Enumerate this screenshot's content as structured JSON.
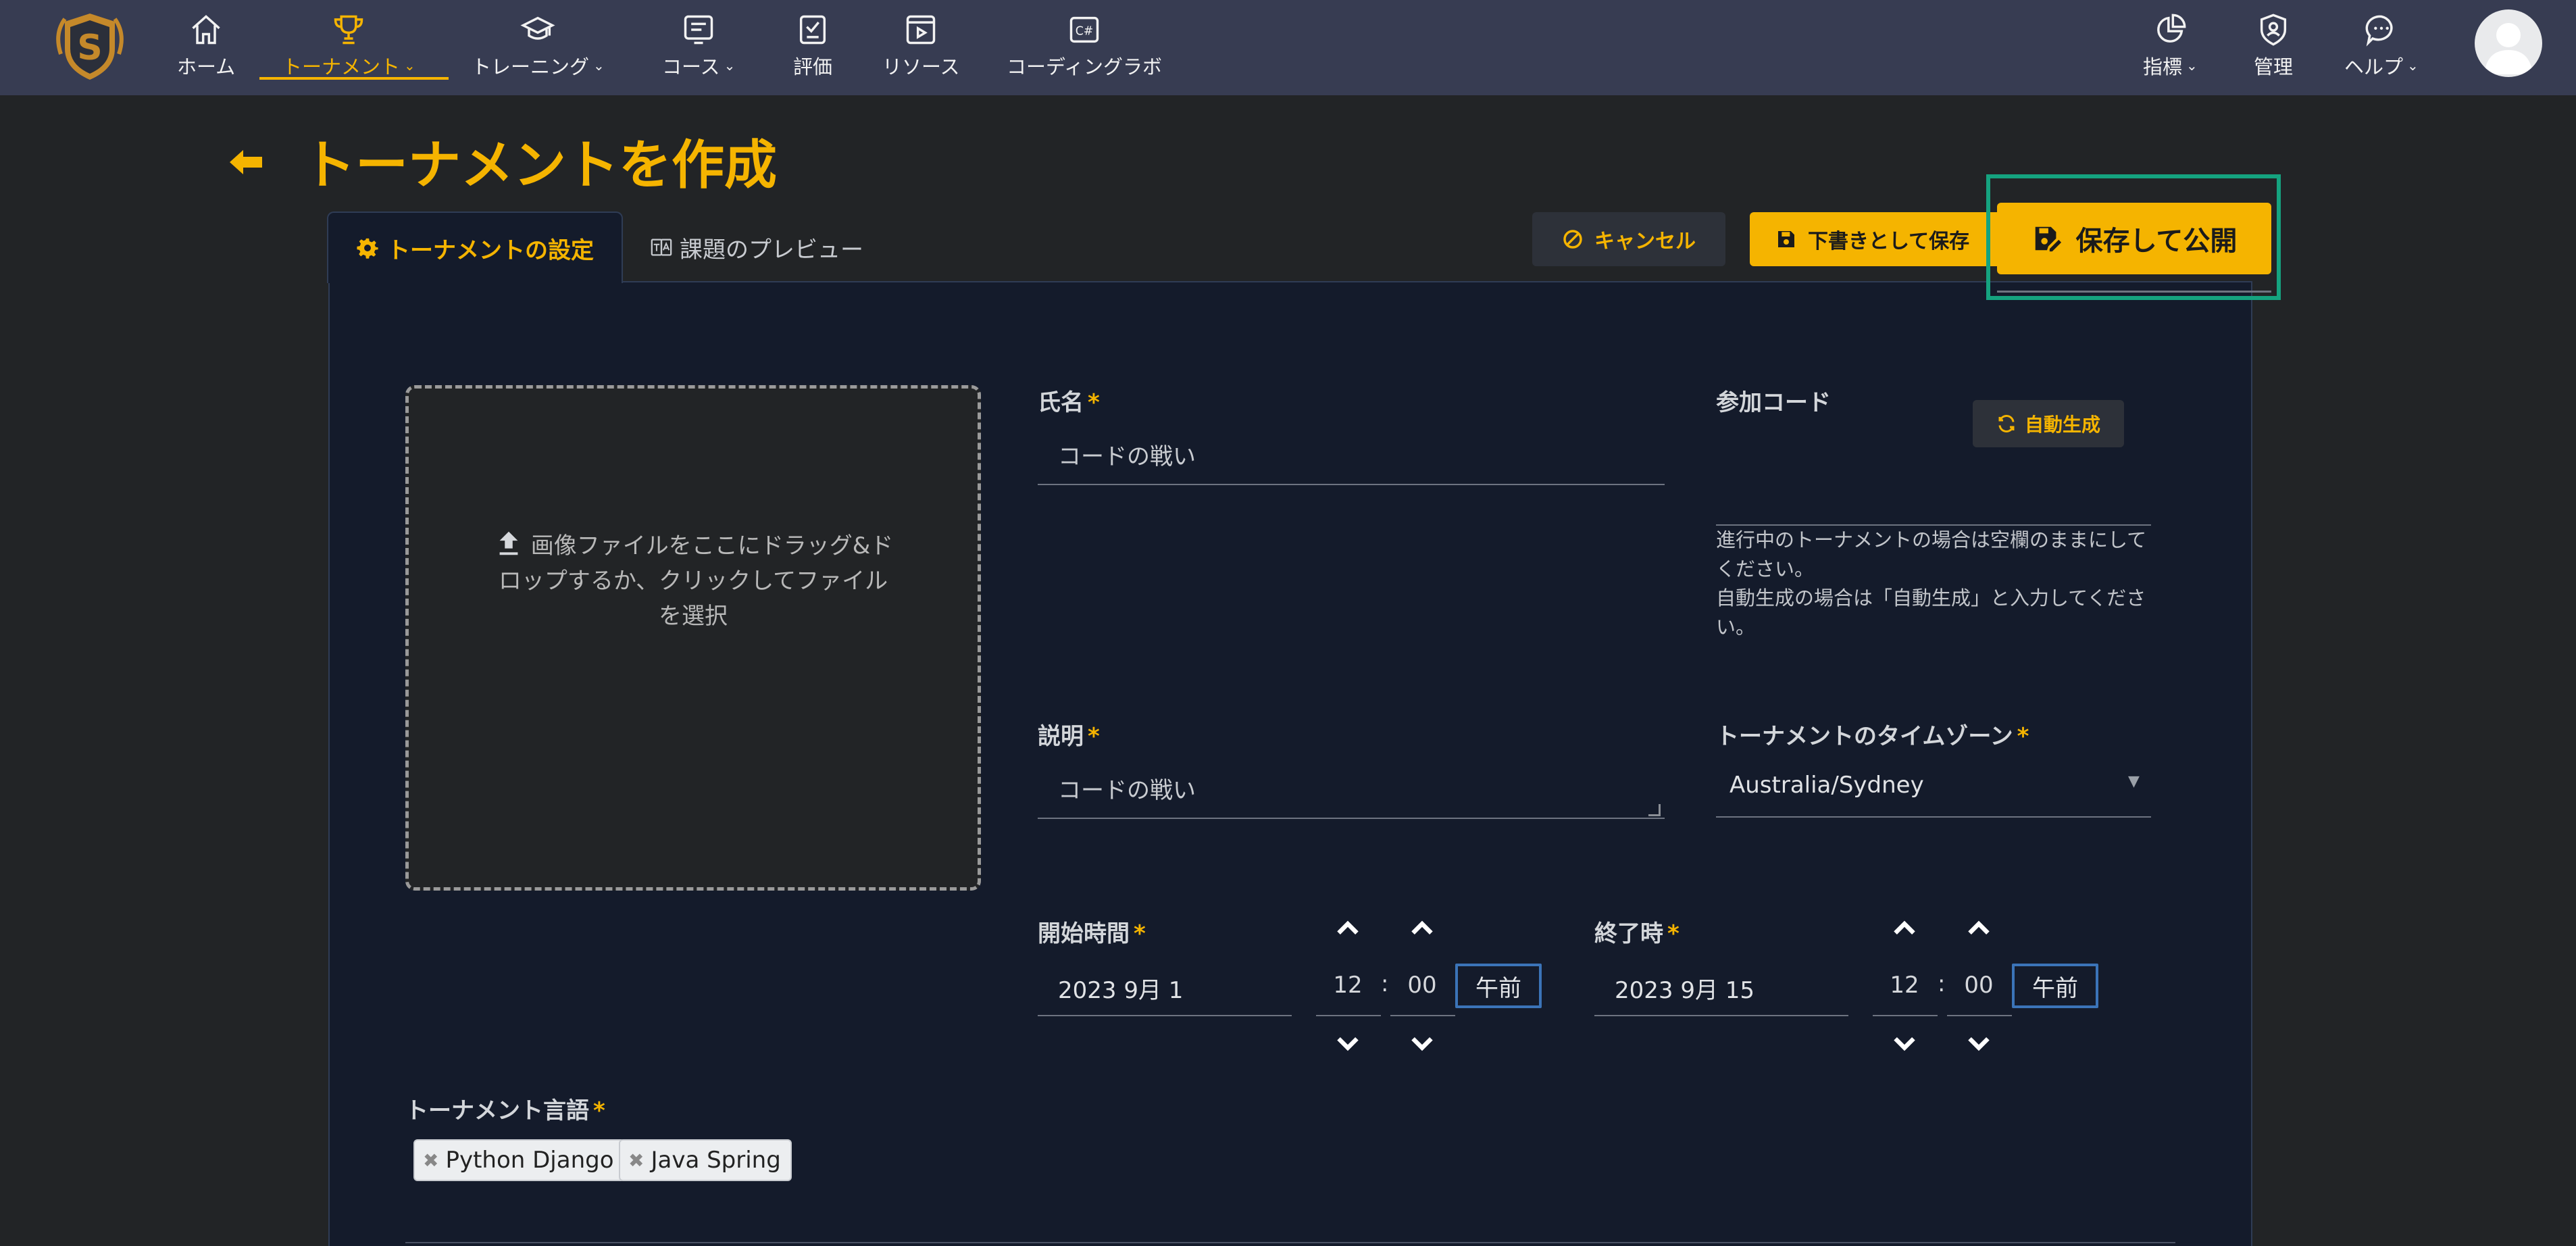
{
  "nav": {
    "items": [
      {
        "label": "ホーム",
        "icon": "home-icon"
      },
      {
        "label": "トーナメント",
        "icon": "trophy-icon",
        "dropdown": true,
        "active": true
      },
      {
        "label": "トレーニング",
        "icon": "graduation-cap-icon",
        "dropdown": true
      },
      {
        "label": "コース",
        "icon": "course-icon",
        "dropdown": true
      },
      {
        "label": "評価",
        "icon": "assessment-icon"
      },
      {
        "label": "リソース",
        "icon": "video-resource-icon"
      },
      {
        "label": "コーディングラボ",
        "icon": "code-lab-icon"
      }
    ],
    "right_items": [
      {
        "label": "指標",
        "icon": "pie-chart-icon",
        "dropdown": true
      },
      {
        "label": "管理",
        "icon": "admin-icon"
      },
      {
        "label": "ヘルプ",
        "icon": "chat-help-icon",
        "dropdown": true
      }
    ],
    "chevron": "⌄"
  },
  "page": {
    "title": "トーナメントを作成"
  },
  "tabs": {
    "settings": "トーナメントの設定",
    "preview": "課題のプレビュー"
  },
  "actions": {
    "cancel": "キャンセル",
    "save_draft": "下書きとして保存",
    "save_publish": "保存して公開"
  },
  "dropzone": {
    "text": "画像ファイルをここにドラッグ&ドロップするか、クリックしてファイルを選択"
  },
  "form": {
    "name_label": "氏名",
    "name_value": "コードの戦い",
    "join_code_label": "参加コード",
    "auto_generate": "自動生成",
    "join_code_hint_1": "進行中のトーナメントの場合は空欄のままにしてください。",
    "join_code_hint_2": "自動生成の場合は「自動生成」と入力してください。",
    "description_label": "説明",
    "description_value": "コードの戦い",
    "timezone_label": "トーナメントのタイムゾーン",
    "timezone_value": "Australia/Sydney",
    "start_label": "開始時間",
    "start_date": "2023 9月 1",
    "start_hour": "12",
    "start_minute": "00",
    "start_ampm": "午前",
    "end_label": "終了時",
    "end_date": "2023 9月 15",
    "end_hour": "12",
    "end_minute": "00",
    "end_ampm": "午前",
    "language_label": "トーナメント言語",
    "languages": [
      "Python Django",
      "Java Spring"
    ],
    "required_mark": "*",
    "colon": ":"
  },
  "colors": {
    "accent": "#f5b400",
    "nav_bg": "#373c52",
    "panel_bg": "#141b2b",
    "highlight": "#15a37f"
  }
}
